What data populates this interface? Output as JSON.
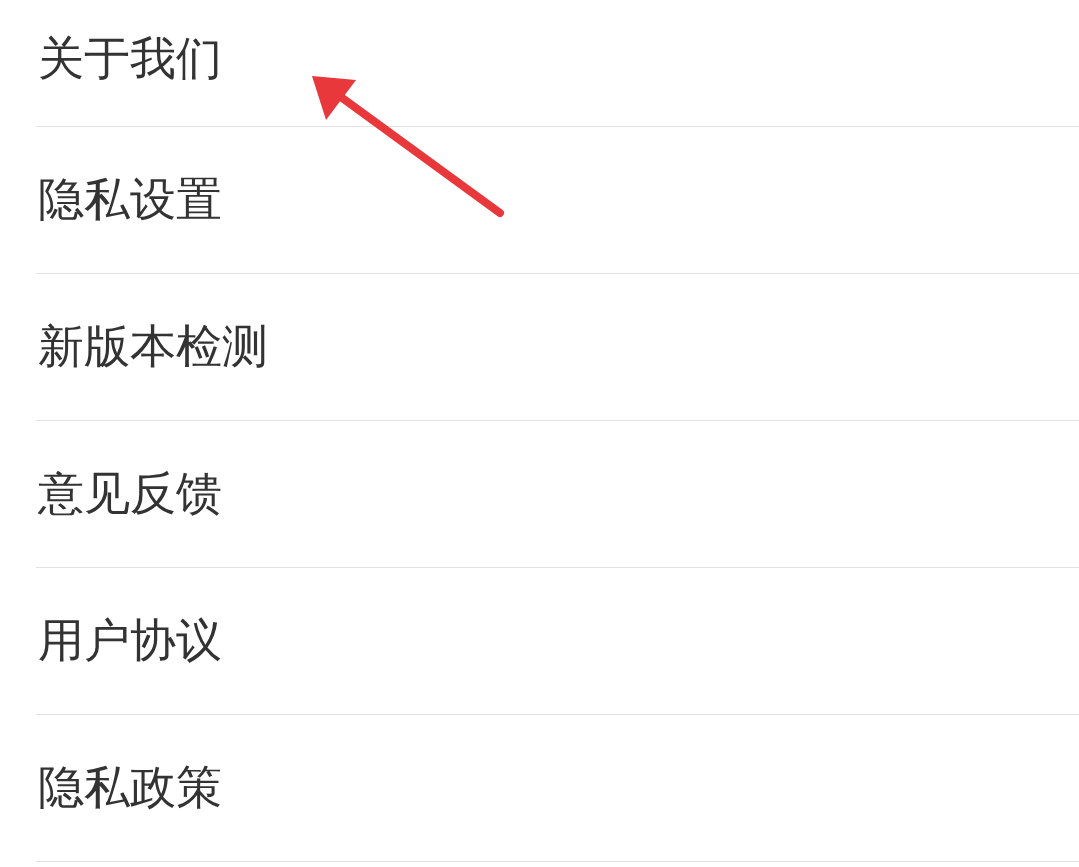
{
  "menu_items": [
    {
      "label": "关于我们"
    },
    {
      "label": "隐私设置"
    },
    {
      "label": "新版本检测"
    },
    {
      "label": "意见反馈"
    },
    {
      "label": "用户协议"
    },
    {
      "label": "隐私政策"
    }
  ]
}
